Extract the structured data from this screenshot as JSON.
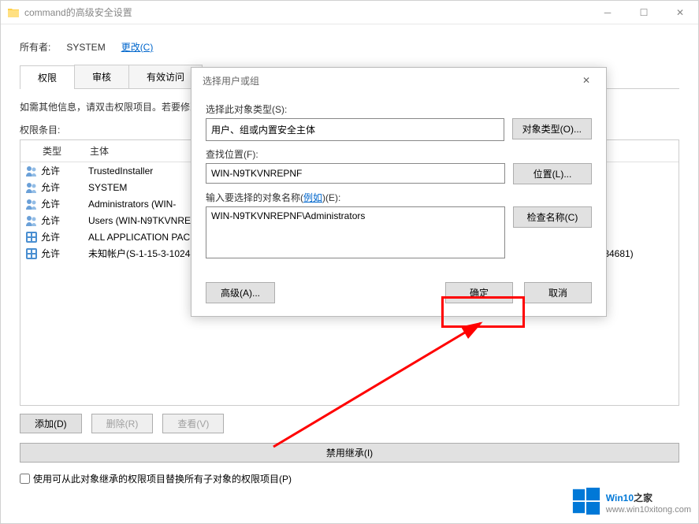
{
  "mainWindow": {
    "title": "command的高级安全设置",
    "owner": {
      "label": "所有者:",
      "value": "SYSTEM",
      "changeLink": "更改(C)"
    },
    "tabs": [
      "权限",
      "审核",
      "有效访问"
    ],
    "helpText": "如需其他信息，请双击权限项目。若要修改权限项目，请选择该项目并单击\"编辑\"(如果可用)。",
    "sectionLabel": "权限条目:",
    "headers": {
      "type": "类型",
      "principal": "主体"
    },
    "rows": [
      {
        "icon": "users",
        "type": "允许",
        "principal": "TrustedInstaller"
      },
      {
        "icon": "users",
        "type": "允许",
        "principal": "SYSTEM"
      },
      {
        "icon": "users",
        "type": "允许",
        "principal": "Administrators (WIN-"
      },
      {
        "icon": "users",
        "type": "允许",
        "principal": "Users (WIN-N9TKVNREPNF\\Users)"
      },
      {
        "icon": "package",
        "type": "允许",
        "principal": "ALL APPLICATION PACKAGES"
      },
      {
        "icon": "package",
        "type": "允许",
        "principal": "未知帐户(S-1-15-3-1024-1065365936-1281604716-3511738428-1654721687-432734479-3232135806-4053264122-3456934681)"
      }
    ],
    "buttons": {
      "add": "添加(D)",
      "remove": "删除(R)",
      "view": "查看(V)",
      "disableInherit": "禁用继承(I)"
    },
    "replaceCheckbox": "使用可从此对象继承的权限项目替换所有子对象的权限项目(P)"
  },
  "modal": {
    "title": "选择用户或组",
    "objectTypeLabel": "选择此对象类型(S):",
    "objectTypeValue": "用户、组或内置安全主体",
    "objectTypeBtn": "对象类型(O)...",
    "locationLabel": "查找位置(F):",
    "locationValue": "WIN-N9TKVNREPNF",
    "locationBtn": "位置(L)...",
    "nameLabelPrefix": "输入要选择的对象名称(",
    "nameExample": "例如",
    "nameLabelSuffix": ")(E):",
    "nameValue": "WIN-N9TKVNREPNF\\Administrators",
    "checkNamesBtn": "检查名称(C)",
    "advancedBtn": "高级(A)...",
    "okBtn": "确定",
    "cancelBtn": "取消"
  },
  "watermark": {
    "brand": "Win10",
    "brandSuffix": "之家",
    "url": "www.win10xitong.com"
  }
}
